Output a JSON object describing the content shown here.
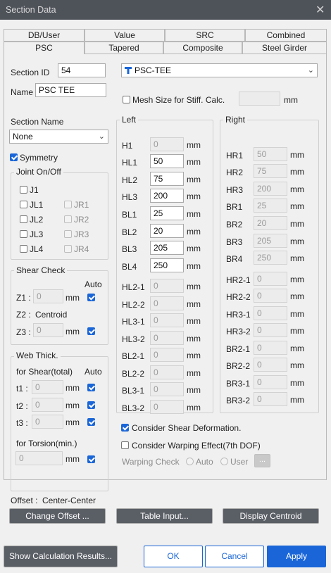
{
  "window": {
    "title": "Section Data",
    "close": "✕"
  },
  "tabs_row1": [
    "DB/User",
    "Value",
    "SRC",
    "Combined"
  ],
  "tabs_row2": [
    "PSC",
    "Tapered",
    "Composite",
    "Steel Girder"
  ],
  "section": {
    "id_label": "Section ID",
    "id_value": "54",
    "name_label": "Name",
    "name_value": "PSC TEE",
    "type_value": "PSC-TEE"
  },
  "mesh": {
    "label": "Mesh Size for Stiff. Calc.",
    "unit": "mm",
    "value": ""
  },
  "section_name": {
    "label": "Section Name",
    "value": "None"
  },
  "symmetry": "Symmetry",
  "joint": {
    "title": "Joint On/Off",
    "left": [
      "J1",
      "JL1",
      "JL2",
      "JL3",
      "JL4"
    ],
    "right": [
      "JR1",
      "JR2",
      "JR3",
      "JR4"
    ]
  },
  "shear_check": {
    "title": "Shear Check",
    "auto": "Auto",
    "z1": "Z1 :",
    "z1_value": "0",
    "z2": "Z2 :",
    "z2_value": "Centroid",
    "z3": "Z3 :",
    "z3_value": "0",
    "unit": "mm"
  },
  "web_thick": {
    "title": "Web Thick.",
    "shear_label": "for Shear(total)",
    "auto": "Auto",
    "t1": "t1 :",
    "t2": "t2 :",
    "t3": "t3 :",
    "t_value": "0",
    "torsion_label": "for Torsion(min.)",
    "torsion_value": "0",
    "unit": "mm"
  },
  "left": {
    "title": "Left",
    "unit": "mm",
    "rows": [
      {
        "k": "H1",
        "v": "0",
        "dis": true
      },
      {
        "k": "HL1",
        "v": "50",
        "dis": false
      },
      {
        "k": "HL2",
        "v": "75",
        "dis": false
      },
      {
        "k": "HL3",
        "v": "200",
        "dis": false
      },
      {
        "k": "BL1",
        "v": "25",
        "dis": false
      },
      {
        "k": "BL2",
        "v": "20",
        "dis": false
      },
      {
        "k": "BL3",
        "v": "205",
        "dis": false
      },
      {
        "k": "BL4",
        "v": "250",
        "dis": false
      },
      {
        "k": "HL2-1",
        "v": "0",
        "dis": true
      },
      {
        "k": "HL2-2",
        "v": "0",
        "dis": true
      },
      {
        "k": "HL3-1",
        "v": "0",
        "dis": true
      },
      {
        "k": "HL3-2",
        "v": "0",
        "dis": true
      },
      {
        "k": "BL2-1",
        "v": "0",
        "dis": true
      },
      {
        "k": "BL2-2",
        "v": "0",
        "dis": true
      },
      {
        "k": "BL3-1",
        "v": "0",
        "dis": true
      },
      {
        "k": "BL3-2",
        "v": "0",
        "dis": true
      }
    ]
  },
  "right": {
    "title": "Right",
    "unit": "mm",
    "rows": [
      {
        "k": "HR1",
        "v": "50"
      },
      {
        "k": "HR2",
        "v": "75"
      },
      {
        "k": "HR3",
        "v": "200"
      },
      {
        "k": "BR1",
        "v": "25"
      },
      {
        "k": "BR2",
        "v": "20"
      },
      {
        "k": "BR3",
        "v": "205"
      },
      {
        "k": "BR4",
        "v": "250"
      },
      {
        "k": "HR2-1",
        "v": "0"
      },
      {
        "k": "HR2-2",
        "v": "0"
      },
      {
        "k": "HR3-1",
        "v": "0"
      },
      {
        "k": "HR3-2",
        "v": "0"
      },
      {
        "k": "BR2-1",
        "v": "0"
      },
      {
        "k": "BR2-2",
        "v": "0"
      },
      {
        "k": "BR3-1",
        "v": "0"
      },
      {
        "k": "BR3-2",
        "v": "0"
      }
    ]
  },
  "options": {
    "shear_def": "Consider Shear Deformation.",
    "warping": "Consider Warping Effect(7th DOF)",
    "warping_check": "Warping Check",
    "auto": "Auto",
    "user": "User",
    "more": "..."
  },
  "offset": {
    "label": "Offset : ",
    "value": "Center-Center"
  },
  "buttons": {
    "change_offset": "Change Offset ...",
    "table_input": "Table Input...",
    "display_centroid": "Display Centroid",
    "show_calc": "Show Calculation Results...",
    "ok": "OK",
    "cancel": "Cancel",
    "apply": "Apply"
  },
  "colors": {
    "accent": "#1a66d8",
    "titlebar": "#4e5259",
    "dialog_bg": "#f0f0f0"
  }
}
